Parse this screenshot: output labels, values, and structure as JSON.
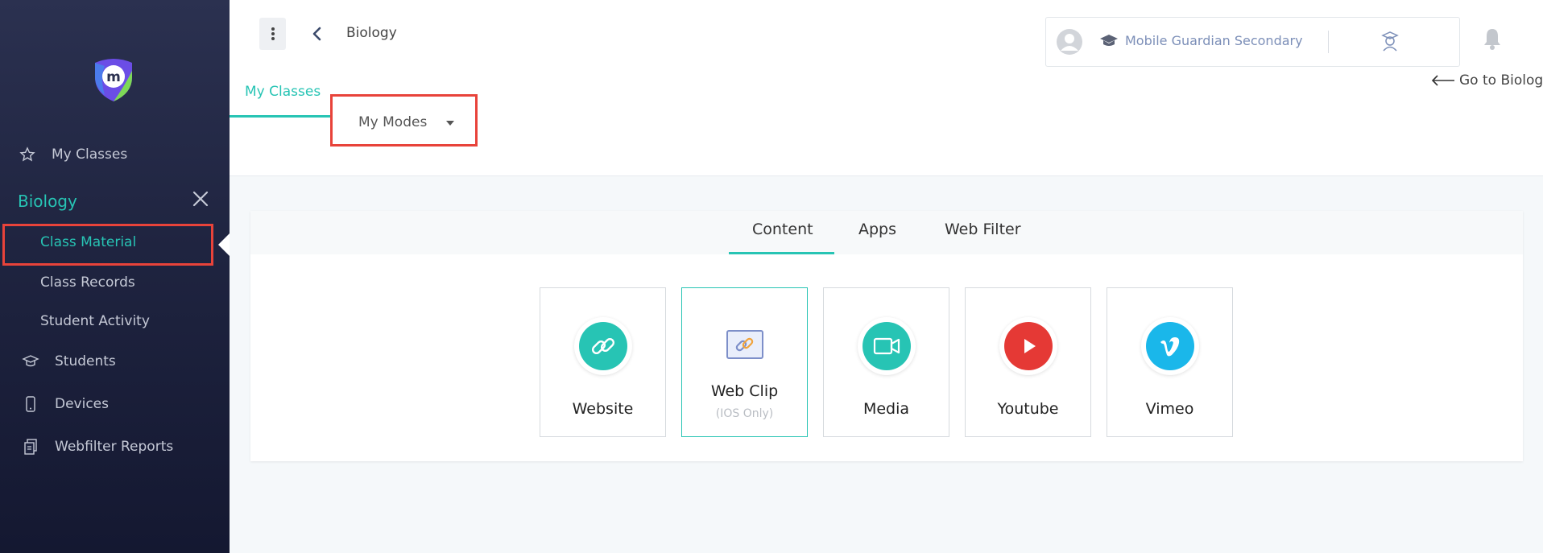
{
  "sidebar": {
    "my_classes": "My Classes",
    "section_title": "Biology",
    "sub_items": [
      "Class Material",
      "Class Records",
      "Student Activity"
    ],
    "items": [
      "Students",
      "Devices",
      "Webfilter Reports"
    ]
  },
  "header": {
    "breadcrumb": "Biology",
    "school_name": "Mobile Guardian Secondary",
    "goto_label": "Go to Biology",
    "tab_my_classes": "My Classes",
    "modes_label": "My Modes"
  },
  "panel": {
    "tabs": [
      "Content",
      "Apps",
      "Web Filter"
    ],
    "cards": [
      {
        "label": "Website",
        "color": "#27c4b4",
        "icon": "link-icon"
      },
      {
        "label": "Web Clip",
        "sub": "(IOS Only)",
        "icon": "webclip-icon"
      },
      {
        "label": "Media",
        "color": "#27c4b4",
        "icon": "video-camera-icon"
      },
      {
        "label": "Youtube",
        "color": "#e53935",
        "icon": "play-icon"
      },
      {
        "label": "Vimeo",
        "color": "#1ab7ea",
        "icon": "vimeo-icon"
      }
    ]
  },
  "colors": {
    "accent": "#27c4b4",
    "highlight": "#e8433a",
    "sidebar_bg": "#1f2440"
  }
}
